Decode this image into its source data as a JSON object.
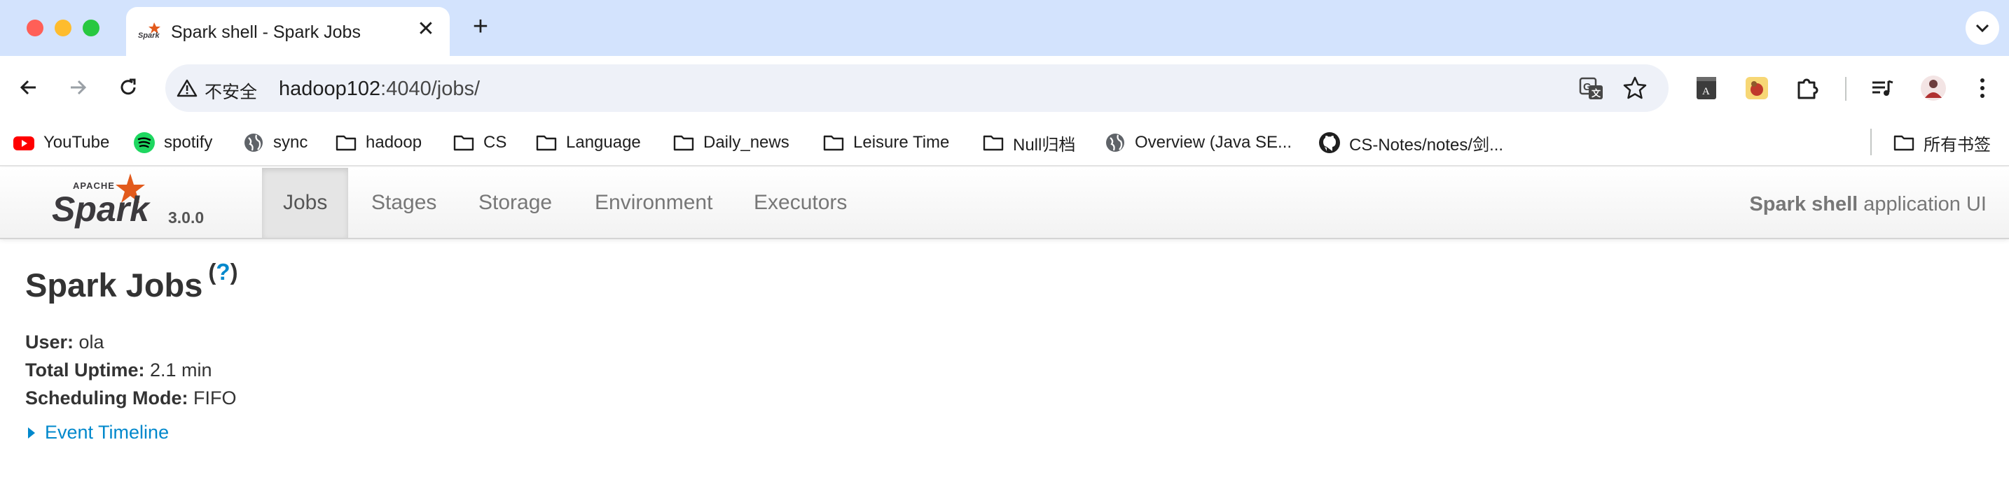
{
  "browser": {
    "tab_title": "Spark shell - Spark Jobs",
    "new_tab_symbol": "+",
    "tab_close_symbol": "✕",
    "omnibox": {
      "security_label": "不安全",
      "url_host": "hadoop102",
      "url_rest": ":4040/jobs/"
    },
    "bookmarks": [
      {
        "label": "YouTube",
        "icon": "youtube-icon"
      },
      {
        "label": "spotify",
        "icon": "spotify-icon"
      },
      {
        "label": "sync",
        "icon": "globe-icon"
      },
      {
        "label": "hadoop",
        "icon": "folder-icon"
      },
      {
        "label": "CS",
        "icon": "folder-icon"
      },
      {
        "label": "Language",
        "icon": "folder-icon"
      },
      {
        "label": "Daily_news",
        "icon": "folder-icon"
      },
      {
        "label": "Leisure Time",
        "icon": "folder-icon"
      },
      {
        "label": "Null归档",
        "icon": "folder-icon"
      },
      {
        "label": "Overview (Java SE...",
        "icon": "globe-icon"
      },
      {
        "label": "CS-Notes/notes/剑...",
        "icon": "github-icon"
      }
    ],
    "all_bookmarks_label": "所有书签"
  },
  "spark": {
    "version": "3.0.0",
    "tabs": [
      {
        "label": "Jobs",
        "active": true
      },
      {
        "label": "Stages",
        "active": false
      },
      {
        "label": "Storage",
        "active": false
      },
      {
        "label": "Environment",
        "active": false
      },
      {
        "label": "Executors",
        "active": false
      }
    ],
    "app_name_bold": "Spark shell",
    "app_name_suffix": " application UI"
  },
  "page": {
    "title": "Spark Jobs",
    "help_open": "(",
    "help_mark": "?",
    "help_close": ")",
    "summary": {
      "user_label": "User:",
      "user_value": " ola",
      "uptime_label": "Total Uptime:",
      "uptime_value": " 2.1 min",
      "mode_label": "Scheduling Mode:",
      "mode_value": " FIFO"
    },
    "event_timeline_label": "Event Timeline"
  },
  "colors": {
    "tab_strip": "#d3e3fd",
    "link": "#0088cc",
    "spark_orange": "#e25a1c"
  }
}
